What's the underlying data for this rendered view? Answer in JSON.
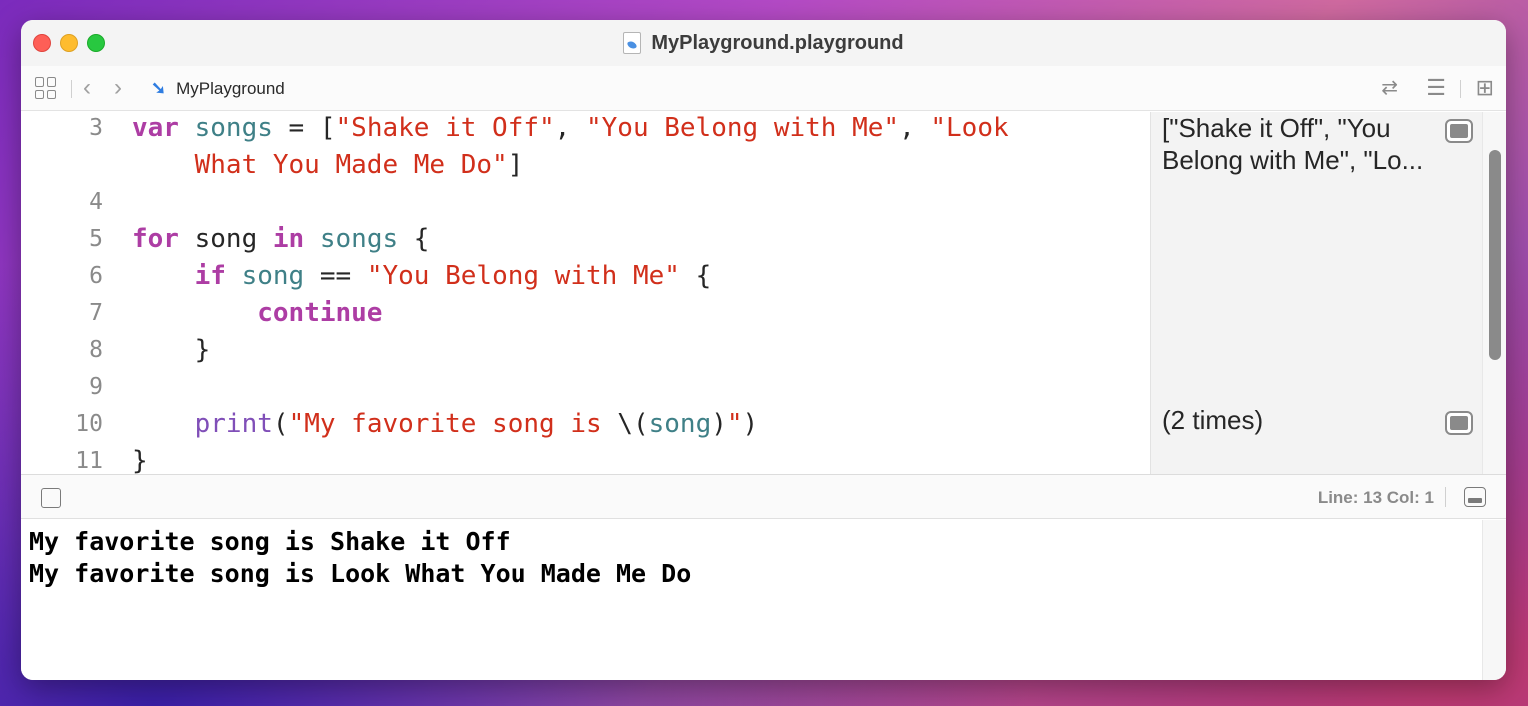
{
  "window": {
    "title": "MyPlayground.playground"
  },
  "toolbar": {
    "breadcrumb": "MyPlayground",
    "icons": [
      "grid-icon",
      "chevron-left-icon",
      "chevron-right-icon",
      "swift-icon",
      "swap-arrows-icon",
      "inspector-lines-icon",
      "add-panel-icon"
    ]
  },
  "editor": {
    "lines": [
      {
        "num": "3",
        "tokens": [
          [
            "kw",
            "var"
          ],
          [
            "",
            ""
          ],
          [
            "id",
            " songs"
          ],
          [
            "",
            " = ["
          ],
          [
            "str",
            "\"Shake it Off\""
          ],
          [
            "",
            ", "
          ],
          [
            "str",
            "\"You Belong with Me\""
          ],
          [
            "",
            ", "
          ],
          [
            "str",
            "\"Look"
          ]
        ]
      },
      {
        "num": "",
        "tokens": [
          [
            "str",
            "    What You Made Me Do\""
          ],
          [
            "",
            "]"
          ]
        ]
      },
      {
        "num": "4",
        "tokens": []
      },
      {
        "num": "5",
        "tokens": [
          [
            "kw",
            "for"
          ],
          [
            "",
            " song "
          ],
          [
            "kw",
            "in"
          ],
          [
            "id",
            " songs"
          ],
          [
            "",
            " {"
          ]
        ]
      },
      {
        "num": "6",
        "tokens": [
          [
            "",
            "    "
          ],
          [
            "kw",
            "if"
          ],
          [
            "id",
            " song"
          ],
          [
            "",
            " == "
          ],
          [
            "str",
            "\"You Belong with Me\""
          ],
          [
            "",
            " {"
          ]
        ]
      },
      {
        "num": "7",
        "tokens": [
          [
            "",
            "        "
          ],
          [
            "kw",
            "continue"
          ]
        ]
      },
      {
        "num": "8",
        "tokens": [
          [
            "",
            "    }"
          ]
        ]
      },
      {
        "num": "9",
        "tokens": []
      },
      {
        "num": "10",
        "tokens": [
          [
            "",
            "    "
          ],
          [
            "fn",
            "print"
          ],
          [
            "",
            "("
          ],
          [
            "str",
            "\"My favorite song is "
          ],
          [
            "",
            "\\("
          ],
          [
            "id",
            "song"
          ],
          [
            "",
            ")"
          ],
          [
            "str",
            "\""
          ],
          [
            "",
            ")"
          ]
        ]
      },
      {
        "num": "11",
        "tokens": [
          [
            "",
            "}"
          ]
        ]
      }
    ]
  },
  "results": {
    "line3_a": "[\"Shake it Off\", \"You",
    "line3_b": "Belong with Me\", \"Lo...",
    "line10": "(2 times)"
  },
  "status": {
    "position": "Line: 13  Col: 1"
  },
  "console": {
    "lines": [
      "My favorite song is Shake it Off",
      "My favorite song is Look What You Made Me Do"
    ]
  },
  "colors": {
    "keyword": "#ad3da4",
    "string": "#d12f1b",
    "identifier": "#3f8087",
    "function": "#804fb8",
    "line_number": "#8a8a8a"
  }
}
